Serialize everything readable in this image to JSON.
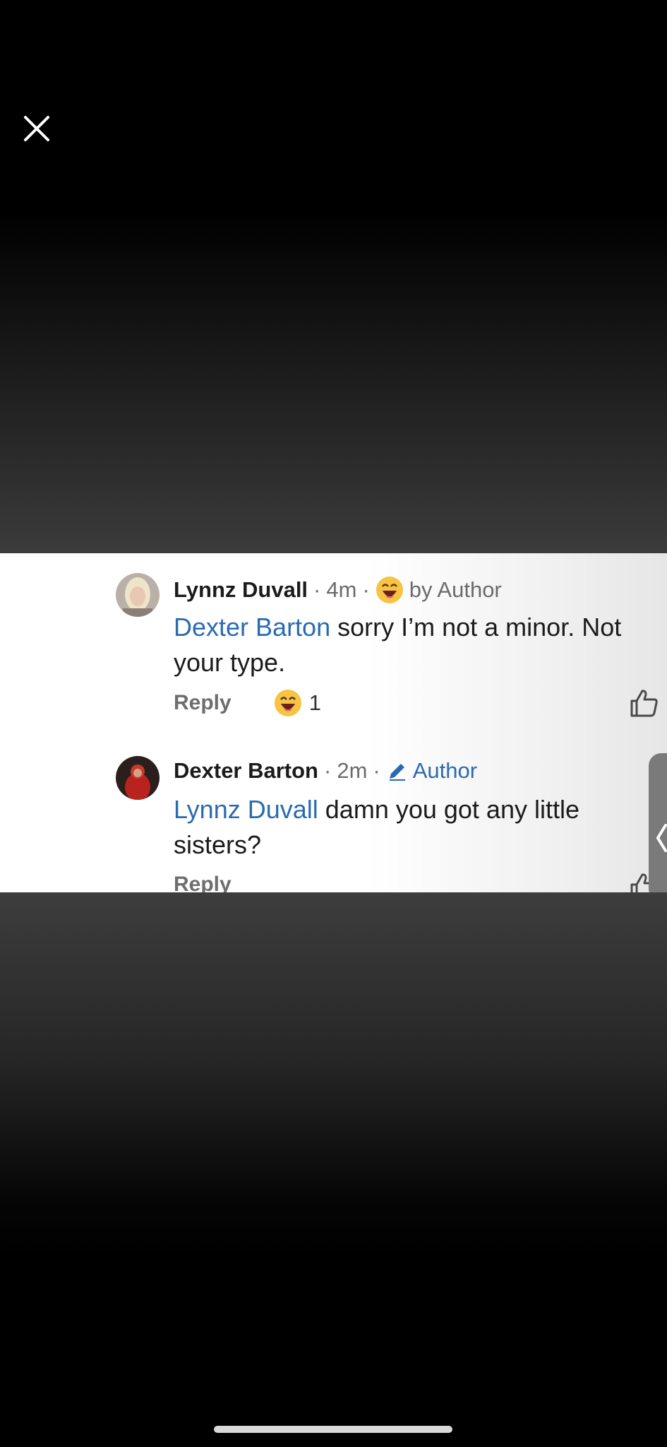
{
  "viewer": {
    "close_icon": "close-icon"
  },
  "comments": [
    {
      "author": "Lynnz Duvall",
      "time": "4m",
      "reaction_note": "by Author",
      "mention": "Dexter Barton",
      "text": " sorry I’m not a minor. Not your type.",
      "reply_label": "Reply",
      "reaction_count": "1",
      "reaction_icon": "laughing-emoji-icon",
      "like_icon": "thumbs-up-icon"
    },
    {
      "author": "Dexter Barton",
      "time": "2m",
      "badge": "Author",
      "badge_icon": "pencil-icon",
      "mention": "Lynnz Duvall",
      "text": " damn you got any little sisters?",
      "reply_label": "Reply",
      "like_icon": "thumbs-up-icon"
    }
  ],
  "colors": {
    "mention": "#2a6ab1",
    "author_badge": "#2a6ab1",
    "name": "#1b1b1b",
    "meta": "#6b6b6b"
  }
}
